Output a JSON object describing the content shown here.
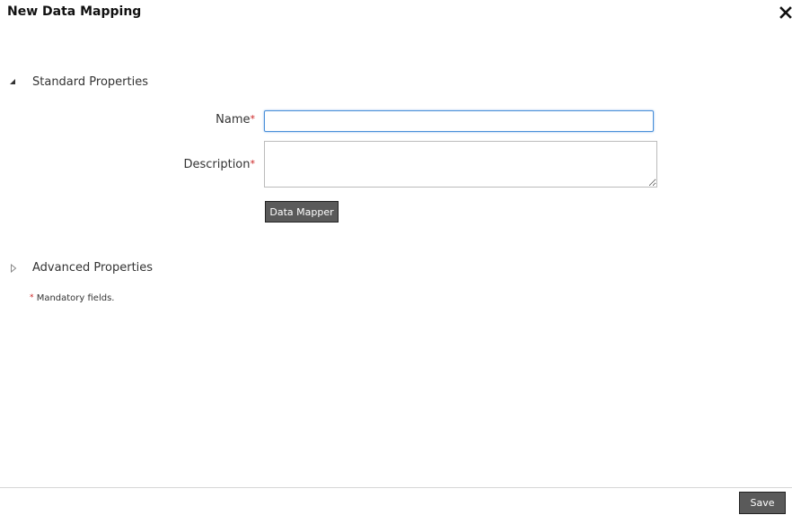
{
  "dialog": {
    "title": "New Data Mapping"
  },
  "sections": {
    "standard": {
      "label": "Standard Properties",
      "expanded": true
    },
    "advanced": {
      "label": "Advanced Properties",
      "expanded": false
    }
  },
  "form": {
    "name_label": "Name",
    "name_value": "",
    "description_label": "Description",
    "description_value": "",
    "required_marker": "*",
    "data_mapper_label": "Data Mapper"
  },
  "footer": {
    "mandatory_marker": "*",
    "mandatory_text": "Mandatory fields.",
    "save_label": "Save"
  },
  "icons": {
    "close": "close-icon",
    "expanded": "triangle-expanded-icon",
    "collapsed": "triangle-collapsed-icon"
  },
  "colors": {
    "required": "#cc2222",
    "focus_border": "#4a90d9",
    "button_bg": "#5a5a5a"
  }
}
